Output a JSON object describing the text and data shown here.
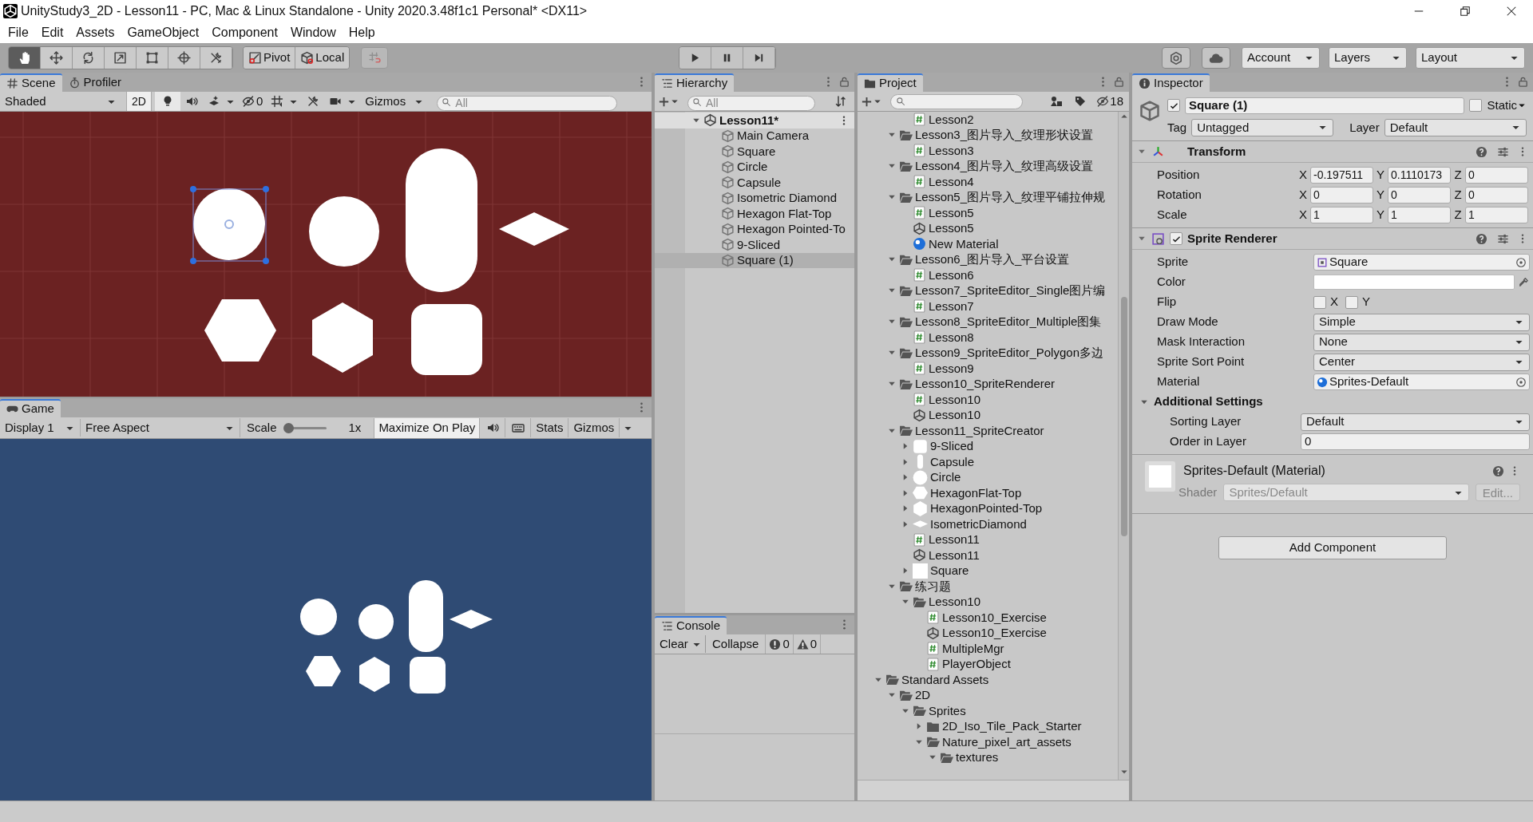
{
  "window": {
    "title": "UnityStudy3_2D - Lesson11 - PC, Mac & Linux Standalone - Unity 2020.3.48f1c1 Personal* <DX11>"
  },
  "menu": [
    "File",
    "Edit",
    "Assets",
    "GameObject",
    "Component",
    "Window",
    "Help"
  ],
  "toolbar": {
    "tools": [
      {
        "kind": "hand",
        "selected": true
      },
      {
        "kind": "move",
        "selected": false
      },
      {
        "kind": "rotate",
        "selected": false
      },
      {
        "kind": "scale",
        "selected": false
      },
      {
        "kind": "rect",
        "selected": false
      },
      {
        "kind": "transform",
        "selected": false
      },
      {
        "kind": "custom",
        "selected": false
      }
    ],
    "pivot": "Pivot",
    "space": "Local",
    "account": "Account",
    "layers": "Layers",
    "layout": "Layout"
  },
  "scene": {
    "tabs": [
      {
        "label": "Scene",
        "kind": "scene",
        "selected": true
      },
      {
        "label": "Profiler",
        "kind": "profiler",
        "selected": false
      }
    ],
    "shading": "Shaded",
    "mode_2d": {
      "label": "2D",
      "on": true
    },
    "hidden_count": "0",
    "gizmos": "Gizmos",
    "search": {
      "placeholder": "All"
    }
  },
  "game": {
    "tab": "Game",
    "display": "Display 1",
    "aspect": "Free Aspect",
    "scale": {
      "label": "Scale",
      "level": 0,
      "reading": "1x"
    },
    "maximize": {
      "label": "Maximize On Play",
      "on": true
    },
    "stats": "Stats",
    "gizmos": "Gizmos"
  },
  "hierarchy": {
    "title": "Hierarchy",
    "search": {
      "placeholder": "All"
    },
    "tree": [
      {
        "label": "Lesson11*",
        "kind": "scene",
        "expanded": true,
        "selected": false,
        "children": [
          {
            "label": "Main Camera",
            "kind": "object",
            "selected": false
          },
          {
            "label": "Square",
            "kind": "object",
            "selected": false
          },
          {
            "label": "Circle",
            "kind": "object",
            "selected": false
          },
          {
            "label": "Capsule",
            "kind": "object",
            "selected": false
          },
          {
            "label": "Isometric Diamond",
            "kind": "object",
            "selected": false
          },
          {
            "label": "Hexagon Flat-Top",
            "kind": "object",
            "selected": false
          },
          {
            "label": "Hexagon Pointed-To",
            "kind": "object",
            "selected": false
          },
          {
            "label": "9-Sliced",
            "kind": "object",
            "selected": false
          },
          {
            "label": "Square (1)",
            "kind": "object",
            "selected": true
          }
        ]
      }
    ]
  },
  "project": {
    "title": "Project",
    "hidden_count": "18",
    "tree": [
      {
        "children": [
          {
            "children": [
              {
                "label": "Lesson2",
                "kind": "script"
              }
            ]
          },
          {
            "label": "Lesson3_图片导入_纹理形状设置",
            "kind": "folder",
            "expanded": true,
            "children": [
              {
                "label": "Lesson3",
                "kind": "script"
              }
            ]
          },
          {
            "label": "Lesson4_图片导入_纹理高级设置",
            "kind": "folder",
            "expanded": true,
            "children": [
              {
                "label": "Lesson4",
                "kind": "script"
              }
            ]
          },
          {
            "label": "Lesson5_图片导入_纹理平铺拉伸规",
            "kind": "folder",
            "expanded": true,
            "children": [
              {
                "label": "Lesson5",
                "kind": "script"
              },
              {
                "label": "Lesson5",
                "kind": "scene"
              },
              {
                "label": "New Material",
                "kind": "material"
              }
            ]
          },
          {
            "label": "Lesson6_图片导入_平台设置",
            "kind": "folder",
            "expanded": true,
            "children": [
              {
                "label": "Lesson6",
                "kind": "script"
              }
            ]
          },
          {
            "label": "Lesson7_SpriteEditor_Single图片编",
            "kind": "folder",
            "expanded": true,
            "children": [
              {
                "label": "Lesson7",
                "kind": "script"
              }
            ]
          },
          {
            "label": "Lesson8_SpriteEditor_Multiple图集",
            "kind": "folder",
            "expanded": true,
            "children": [
              {
                "label": "Lesson8",
                "kind": "script"
              }
            ]
          },
          {
            "label": "Lesson9_SpriteEditor_Polygon多边",
            "kind": "folder",
            "expanded": true,
            "children": [
              {
                "label": "Lesson9",
                "kind": "script"
              }
            ]
          },
          {
            "label": "Lesson10_SpriteRenderer",
            "kind": "folder",
            "expanded": true,
            "children": [
              {
                "label": "Lesson10",
                "kind": "script"
              },
              {
                "label": "Lesson10",
                "kind": "scene"
              }
            ]
          },
          {
            "label": "Lesson11_SpriteCreator",
            "kind": "folder",
            "expanded": true,
            "children": [
              {
                "label": "9-Sliced",
                "kind": "sliced",
                "expanded": false
              },
              {
                "label": "Capsule",
                "kind": "capsule",
                "expanded": false
              },
              {
                "label": "Circle",
                "kind": "circle",
                "expanded": false
              },
              {
                "label": "HexagonFlat-Top",
                "kind": "hexflat",
                "expanded": false
              },
              {
                "label": "HexagonPointed-Top",
                "kind": "hexpointed",
                "expanded": false
              },
              {
                "label": "IsometricDiamond",
                "kind": "diamond",
                "expanded": false
              },
              {
                "label": "Lesson11",
                "kind": "script"
              },
              {
                "label": "Lesson11",
                "kind": "scene"
              },
              {
                "label": "Square",
                "kind": "square",
                "expanded": false
              }
            ]
          },
          {
            "label": "练习题",
            "kind": "folder",
            "expanded": true,
            "children": [
              {
                "label": "Lesson10",
                "kind": "folder",
                "expanded": true,
                "children": [
                  {
                    "label": "Lesson10_Exercise",
                    "kind": "script"
                  },
                  {
                    "label": "Lesson10_Exercise",
                    "kind": "scene"
                  },
                  {
                    "label": "MultipleMgr",
                    "kind": "script"
                  },
                  {
                    "label": "PlayerObject",
                    "kind": "script"
                  }
                ]
              }
            ]
          }
        ]
      },
      {
        "label": "Standard Assets",
        "kind": "folder",
        "expanded": true,
        "children": [
          {
            "label": "2D",
            "kind": "folder",
            "expanded": true,
            "children": [
              {
                "label": "Sprites",
                "kind": "folder",
                "expanded": true,
                "children": [
                  {
                    "label": "2D_Iso_Tile_Pack_Starter",
                    "kind": "folder",
                    "expanded": false
                  },
                  {
                    "label": "Nature_pixel_art_assets",
                    "kind": "folder",
                    "expanded": true,
                    "children": [
                      {
                        "label": "textures",
                        "kind": "folder",
                        "expanded": true
                      }
                    ]
                  }
                ]
              }
            ]
          }
        ]
      }
    ]
  },
  "console": {
    "title": "Console",
    "clear": "Clear",
    "collapse": "Collapse",
    "errors": "0",
    "warnings": "0"
  },
  "inspector": {
    "title": "Inspector",
    "object": {
      "active": true,
      "name": "Square (1)",
      "static": false,
      "static_label": "Static",
      "tag_label": "Tag",
      "tag": "Untagged",
      "layer_label": "Layer",
      "layer": "Default"
    },
    "transform": {
      "title": "Transform",
      "expanded": true,
      "rows": [
        {
          "label": "Position",
          "fields": [
            {
              "axis": "X",
              "value": "-0.197511"
            },
            {
              "axis": "Y",
              "value": "0.1110173"
            },
            {
              "axis": "Z",
              "value": "0"
            }
          ]
        },
        {
          "label": "Rotation",
          "fields": [
            {
              "axis": "X",
              "value": "0"
            },
            {
              "axis": "Y",
              "value": "0"
            },
            {
              "axis": "Z",
              "value": "0"
            }
          ]
        },
        {
          "label": "Scale",
          "fields": [
            {
              "axis": "X",
              "value": "1"
            },
            {
              "axis": "Y",
              "value": "1"
            },
            {
              "axis": "Z",
              "value": "1"
            }
          ]
        }
      ]
    },
    "sprite_renderer": {
      "title": "Sprite Renderer",
      "enabled": true,
      "expanded": true,
      "rows": [
        {
          "kind": "object",
          "label": "Sprite",
          "value": "Square"
        },
        {
          "kind": "color",
          "label": "Color",
          "color": "#ffffff"
        },
        {
          "kind": "flip",
          "label": "Flip",
          "toggles": [
            {
              "label": "X",
              "checked": false
            },
            {
              "label": "Y",
              "checked": false
            }
          ]
        },
        {
          "kind": "dropdown",
          "label": "Draw Mode",
          "value": "Simple"
        },
        {
          "kind": "dropdown",
          "label": "Mask Interaction",
          "value": "None"
        },
        {
          "kind": "dropdown",
          "label": "Sprite Sort Point",
          "value": "Center"
        },
        {
          "kind": "material",
          "label": "Material",
          "value": "Sprites-Default"
        }
      ],
      "additional": {
        "title": "Additional Settings",
        "expanded": true,
        "rows": [
          {
            "kind": "dropdown",
            "label": "Sorting Layer",
            "value": "Default"
          },
          {
            "kind": "text",
            "label": "Order in Layer",
            "value": "0"
          }
        ]
      }
    },
    "material": {
      "title": "Sprites-Default (Material)",
      "shader_label": "Shader",
      "shader": "Sprites/Default",
      "edit": "Edit..."
    },
    "add_component": "Add Component"
  }
}
